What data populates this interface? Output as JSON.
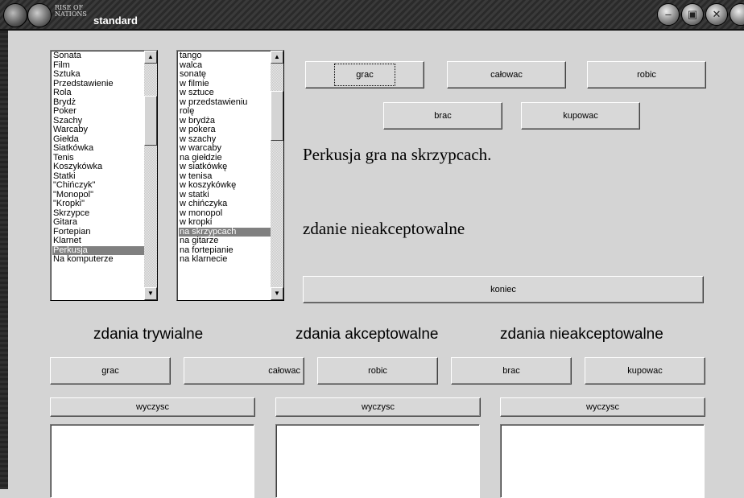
{
  "window": {
    "logo_text": "RISE OF NATIONS",
    "title": "standard",
    "controls": {
      "minimize_icon": "minimize-icon",
      "restore_icon": "restore-icon",
      "close_icon": "close-icon"
    }
  },
  "list_nouns": {
    "items": [
      "Sonata",
      "Film",
      "Sztuka",
      "Przedstawienie",
      "Rola",
      "Brydż",
      "Poker",
      "Szachy",
      "Warcaby",
      "Giełda",
      "Siatkówka",
      "Tenis",
      "Koszykówka",
      "Statki",
      "\"Chińczyk\"",
      "\"Monopol\"",
      "\"Kropki\"",
      "Skrzypce",
      "Gitara",
      "Fortepian",
      "Klarnet",
      "Perkusja",
      "Na komputerze"
    ],
    "selected": "Perkusja"
  },
  "list_places": {
    "items": [
      "tango",
      "walca",
      "sonatę",
      "w filmie",
      "w sztuce",
      "w przedstawieniu",
      "rolę",
      "w brydża",
      "w pokera",
      "w szachy",
      "w warcaby",
      "na giełdzie",
      "w siatkówkę",
      "w tenisa",
      "w koszykówkę",
      "w statki",
      "w chińczyka",
      "w monopol",
      "w kropki",
      "na skrzypcach",
      "na gitarze",
      "na fortepianie",
      "na klarnecie"
    ],
    "selected": "na skrzypcach"
  },
  "verbs_top": {
    "grac": "grac",
    "calowac": "całowac",
    "robic": "robic",
    "brac": "brac",
    "kupowac": "kupowac"
  },
  "sentence": "Perkusja gra na skrzypcach.",
  "verdict": "zdanie nieakceptowalne",
  "end_button": "koniec",
  "headings": {
    "trivial": "zdania trywialne",
    "accepted": "zdania akceptowalne",
    "unaccepted": "zdania nieakceptowalne"
  },
  "verbs_bottom": {
    "grac": "grac",
    "calowac": "całowac",
    "robic": "robic",
    "brac": "brac",
    "kupowac": "kupowac"
  },
  "clear_label": "wyczysc"
}
